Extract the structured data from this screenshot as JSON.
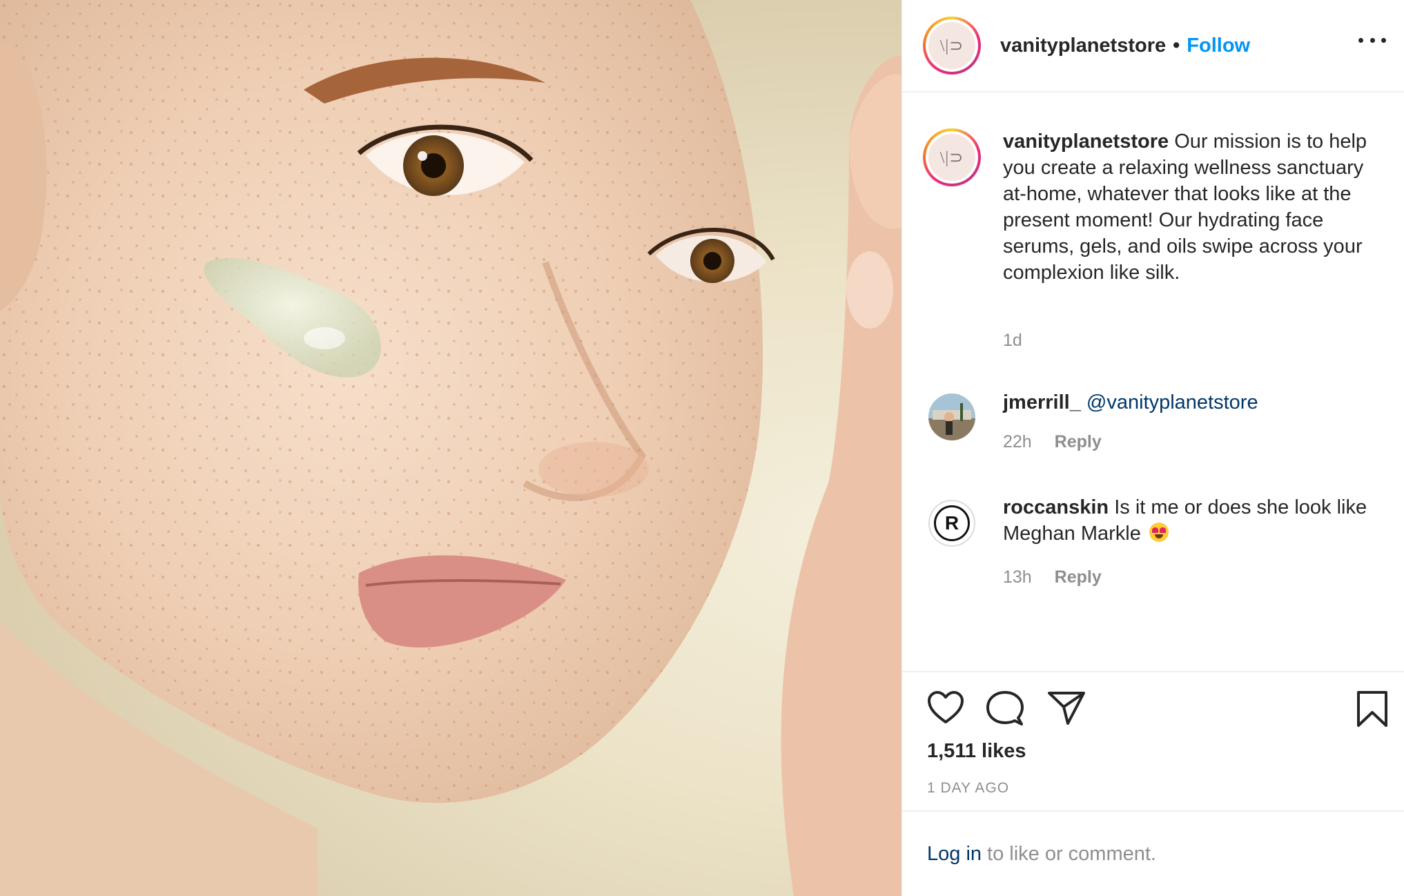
{
  "post": {
    "username": "vanityplanetstore",
    "separator": "•",
    "follow_label": "Follow",
    "avatar_monogram": "\\|⊃",
    "more_icon": "more-horizontal-icon",
    "photo_icon": "face-photo"
  },
  "caption": {
    "username": "vanityplanetstore",
    "text": "Our mission is to help you create a relaxing wellness sanctuary at-home, whatever that looks like at the present moment! Our hydrating face serums, gels, and oils swipe across your complexion like silk.",
    "time": "1d"
  },
  "comments": [
    {
      "username": "jmerrill_",
      "mention": "@vanityplanetstore",
      "text": "",
      "time": "22h",
      "reply_label": "Reply"
    },
    {
      "username": "roccanskin",
      "mention": "",
      "text": "Is it me or does she look like Meghan Markle",
      "avatar_letter": "R",
      "emoji": "heart-eyes-emoji",
      "time": "13h",
      "reply_label": "Reply"
    }
  ],
  "actions": {
    "like_icon": "heart-icon",
    "comment_icon": "comment-icon",
    "share_icon": "share-icon",
    "save_icon": "bookmark-icon"
  },
  "stats": {
    "likes": "1,511 likes",
    "posted": "1 DAY AGO"
  },
  "login": {
    "link_label": "Log in",
    "rest": "to like or comment."
  },
  "colors": {
    "accent": "#0095f6",
    "text": "#262626",
    "muted": "#8e8e8e",
    "mention": "#00376b"
  }
}
